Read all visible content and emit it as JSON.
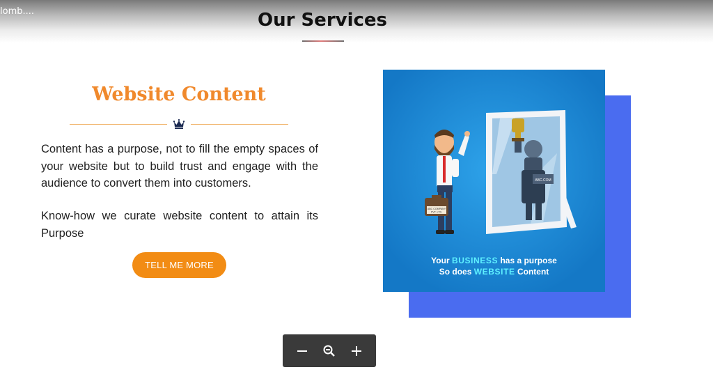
{
  "window": {
    "title": "lomb...."
  },
  "header": {
    "title": "Our Services"
  },
  "service": {
    "heading": "Website Content",
    "paragraph1": "Content has a purpose, not to fill the empty spaces of your website but to build trust and engage with the audience to convert them into customers.",
    "paragraph2": "Know-how we curate website content to attain its Purpose",
    "button_label": "TELL ME MORE"
  },
  "illustration": {
    "briefcase_label_1": "ABC COMPANY",
    "briefcase_label_2": "PVT. LTD.",
    "reflection_label": "ABC.COM",
    "caption_line1_a": "Your ",
    "caption_line1_b": "BUSINESS",
    "caption_line1_c": " has a purpose",
    "caption_line2_a": "So does ",
    "caption_line2_b": "WEBSITE",
    "caption_line2_c": " Content"
  },
  "zoom_toolbar": {
    "zoom_out": "zoom-out-icon",
    "zoom_reset": "magnifier-icon",
    "zoom_in": "zoom-in-icon"
  },
  "colors": {
    "heading_orange": "#f0892c",
    "button_orange": "#f28c14",
    "illustration_blue": "#1a89d8",
    "shadow_blue": "#4a6cf0",
    "toolbar_dark": "#3a3a3a"
  }
}
